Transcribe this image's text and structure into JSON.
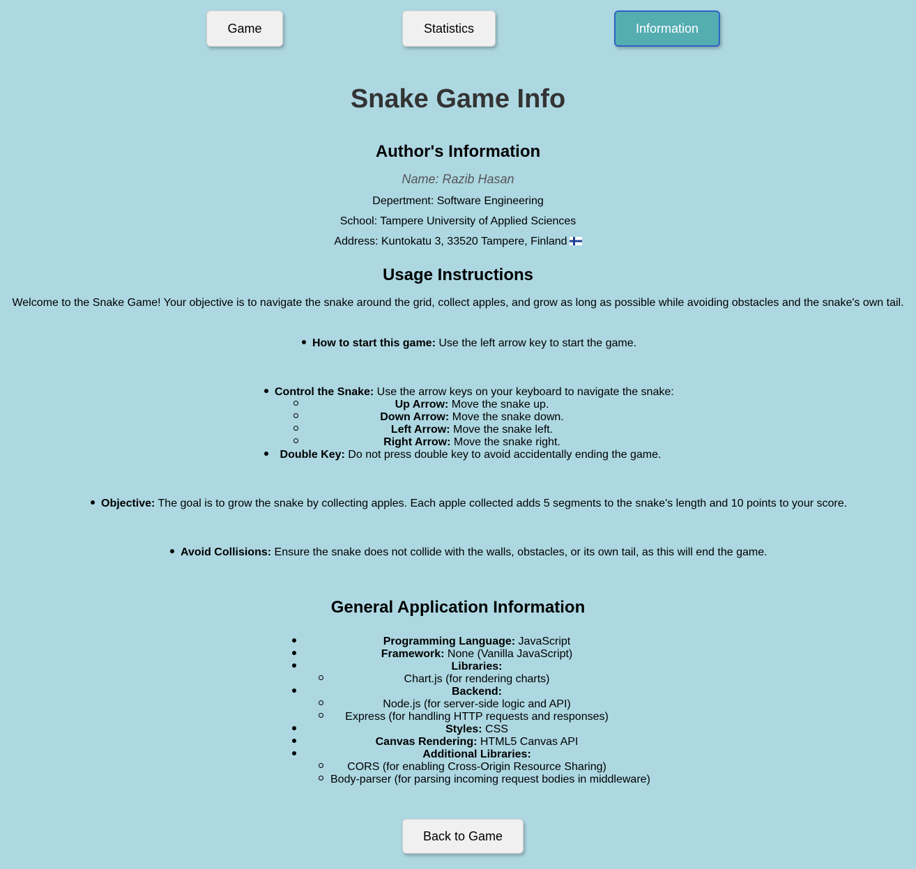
{
  "nav": {
    "game": "Game",
    "statistics": "Statistics",
    "information": "Information"
  },
  "page_title": "Snake Game Info",
  "author": {
    "heading": "Author's Information",
    "name": "Name: Razib Hasan",
    "department": "Depertment: Software Engineering",
    "school": "School: Tampere University of Applied Sciences",
    "address": "Address: Kuntokatu 3, 33520 Tampere, Finland",
    "flag_icon": "finland-flag-icon"
  },
  "usage": {
    "heading": "Usage Instructions",
    "welcome": "Welcome to the Snake Game! Your objective is to navigate the snake around the grid, collect apples, and grow as long as possible while avoiding obstacles and the snake's own tail.",
    "start": {
      "label": "How to start this game:",
      "text": " Use the left arrow key to start the game."
    },
    "control": {
      "label": "Control the Snake:",
      "text": " Use the arrow keys on your keyboard to navigate the snake:",
      "keys": [
        {
          "label": "Up Arrow:",
          "text": " Move the snake up."
        },
        {
          "label": "Down Arrow:",
          "text": " Move the snake down."
        },
        {
          "label": "Left Arrow:",
          "text": " Move the snake left."
        },
        {
          "label": "Right Arrow:",
          "text": " Move the snake right."
        }
      ]
    },
    "double_key": {
      "label": "Double Key:",
      "text": " Do not press double key to avoid accidentally ending the game."
    },
    "objective": {
      "label": "Objective:",
      "text": " The goal is to grow the snake by collecting apples. Each apple collected adds 5 segments to the snake's length and 10 points to your score."
    },
    "collisions": {
      "label": "Avoid Collisions:",
      "text": " Ensure the snake does not collide with the walls, obstacles, or its own tail, as this will end the game."
    }
  },
  "general": {
    "heading": "General Application Information",
    "language": {
      "label": "Programming Language:",
      "text": " JavaScript"
    },
    "framework": {
      "label": "Framework:",
      "text": " None (Vanilla JavaScript)"
    },
    "libraries": {
      "label": "Libraries:",
      "items": [
        "Chart.js (for rendering charts)"
      ]
    },
    "backend": {
      "label": "Backend:",
      "items": [
        "Node.js (for server-side logic and API)",
        "Express (for handling HTTP requests and responses)"
      ]
    },
    "styles": {
      "label": "Styles:",
      "text": " CSS"
    },
    "canvas": {
      "label": "Canvas Rendering:",
      "text": " HTML5 Canvas API"
    },
    "additional": {
      "label": "Additional Libraries:",
      "items": [
        "CORS (for enabling Cross-Origin Resource Sharing)",
        "Body-parser (for parsing incoming request bodies in middleware)"
      ]
    }
  },
  "back_button": "Back to Game",
  "colors": {
    "background": "#add8e2",
    "active_tab": "#54adb1",
    "active_tab_border": "#2f63c8",
    "button": "#f0f0f0"
  }
}
